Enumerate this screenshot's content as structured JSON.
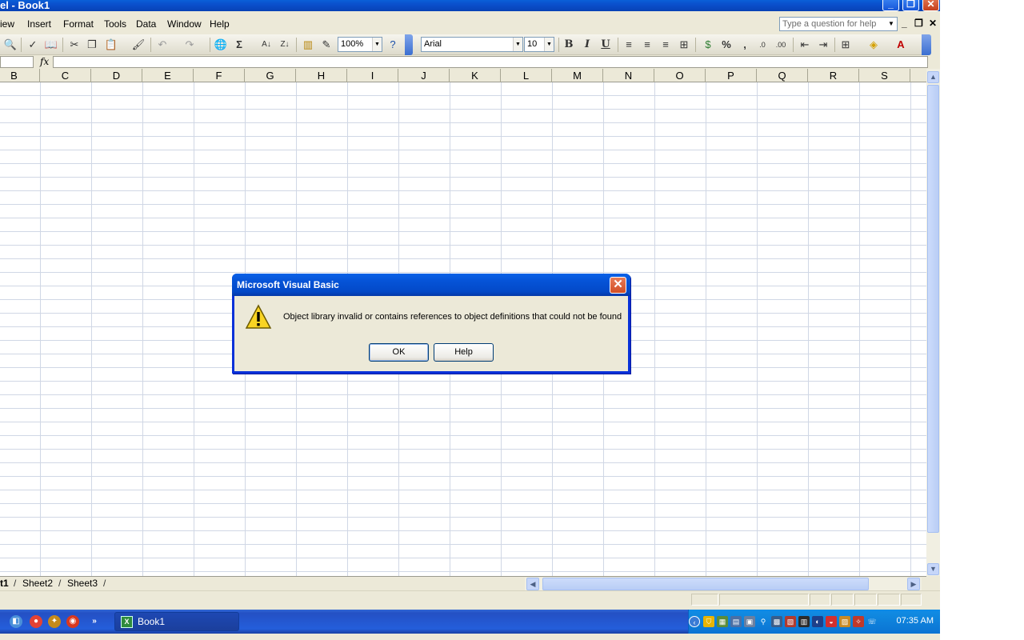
{
  "window": {
    "title": "el - Book1",
    "minimize": "_",
    "restore": "❐",
    "close": "✕"
  },
  "menu": {
    "items": [
      {
        "label": "View",
        "display": "iew"
      },
      {
        "label": "Insert"
      },
      {
        "label": "Format"
      },
      {
        "label": "Tools"
      },
      {
        "label": "Data"
      },
      {
        "label": "Window"
      },
      {
        "label": "Help"
      }
    ],
    "help_placeholder": "Type a question for help"
  },
  "toolbar": {
    "zoom": "100%",
    "font": "Arial",
    "font_size": "10",
    "bold": "B",
    "italic": "I",
    "underline": "U",
    "sum": "Σ",
    "percent": "%",
    "comma": ","
  },
  "formula_bar": {
    "fx": "fx"
  },
  "columns": [
    "B",
    "C",
    "D",
    "E",
    "F",
    "G",
    "H",
    "I",
    "J",
    "K",
    "L",
    "M",
    "N",
    "O",
    "P",
    "Q",
    "R",
    "S"
  ],
  "sheets": [
    "t1",
    "Sheet2",
    "Sheet3"
  ],
  "dialog": {
    "title": "Microsoft Visual Basic",
    "message": "Object library invalid or contains references to object definitions that could not be found",
    "ok": "OK",
    "help": "Help",
    "close": "✕"
  },
  "taskbar": {
    "task_label": "Book1",
    "clock": "07:35 AM"
  },
  "colors": {
    "title_blue": "#0a4fcc",
    "dialog_border": "#0831d9",
    "taskbar_blue": "#245edb",
    "tray_blue": "#0f8be8"
  }
}
